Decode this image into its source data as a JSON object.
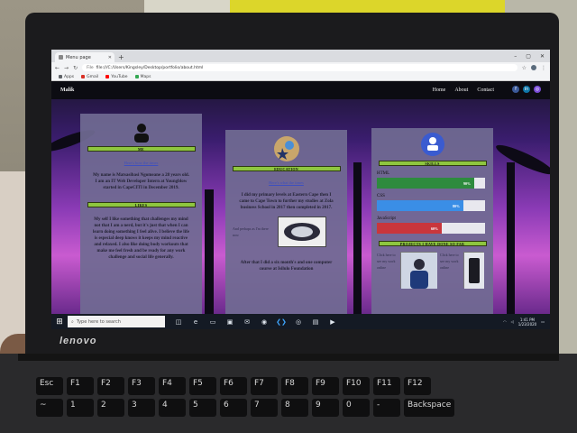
{
  "laptop": {
    "brand": "lenovo"
  },
  "browser": {
    "tab_title": "Menu page",
    "new_tab_symbol": "+",
    "url": "file:///C:/Users/Kingsley/Desktop/portfolio/about.html",
    "url_prefix": "File",
    "bookmarks": [
      {
        "label": "Apps",
        "color": "#5f6368"
      },
      {
        "label": "Gmail",
        "color": "#d93025"
      },
      {
        "label": "YouTube",
        "color": "#ff0000"
      },
      {
        "label": "Maps",
        "color": "#34a853"
      }
    ],
    "win_minimize": "–",
    "win_maximize": "▢",
    "win_close": "✕"
  },
  "site": {
    "logo": "Malik",
    "nav": [
      "Home",
      "About",
      "Contact"
    ],
    "social": [
      {
        "name": "facebook-icon",
        "glyph": "f",
        "color": "#3b5998"
      },
      {
        "name": "linkedin-icon",
        "glyph": "in",
        "color": "#0e76a8"
      },
      {
        "name": "instagram-icon",
        "glyph": "◎",
        "color": "#7a4bd8"
      }
    ]
  },
  "cards": {
    "me": {
      "title": "ME",
      "link": "Here's how the times",
      "paragraph": "My name is Matsasibasi Ngomeane a 28 years old. I am an IT Web Developer Intern at Youngblow started in CapeCITI in December 2019.",
      "likes_title": "LIKES",
      "likes_paragraph": "My self I like something that challenges my mind not that I am a nerd, but it's just that when I can learn doing something I feel alive. I believe the life is especial deep knows it keeps my mind reactive and relaxed. I also like doing body workouts that make me feel fresh and be ready for any work challenge and social life generally."
    },
    "education": {
      "title": "EDUCATION",
      "link": "Here's what the times",
      "paragraph": "I did my primary levels at Eastern Cape then I came to Cape Town to further my studies at Zola business School in 2017 then completed in 2017.",
      "small_text": "And perhaps as I'm there now",
      "paragraph2": "After that I did a six month's and one computer course at Isilulo Foundation"
    },
    "skills": {
      "title": "SKILLS",
      "items": [
        {
          "label": "HTML",
          "percent": "90%",
          "fraction": 0.9,
          "color": "#2e8b3e"
        },
        {
          "label": "CSS",
          "percent": "80%",
          "fraction": 0.8,
          "color": "#3a8ee6"
        },
        {
          "label": "JavaScript",
          "percent": "60%",
          "fraction": 0.6,
          "color": "#c9363c"
        }
      ],
      "projects_title": "PROJECTS I HAVE DONE SO FAR",
      "project_text1": "Click here to see my work online",
      "project_text2": "Click here to see my work online"
    }
  },
  "taskbar": {
    "search_placeholder": "Type here to search",
    "time": "1:41 PM",
    "date": "1/23/2020"
  },
  "keyboard": {
    "row1": [
      "Esc",
      "F1",
      "F2",
      "F3",
      "F4",
      "F5",
      "F6",
      "F7",
      "F8",
      "F9",
      "F10",
      "F11",
      "F12"
    ],
    "row2": [
      "~",
      "1",
      "2",
      "3",
      "4",
      "5",
      "6",
      "7",
      "8",
      "9",
      "0",
      "-",
      "Backspace"
    ]
  }
}
